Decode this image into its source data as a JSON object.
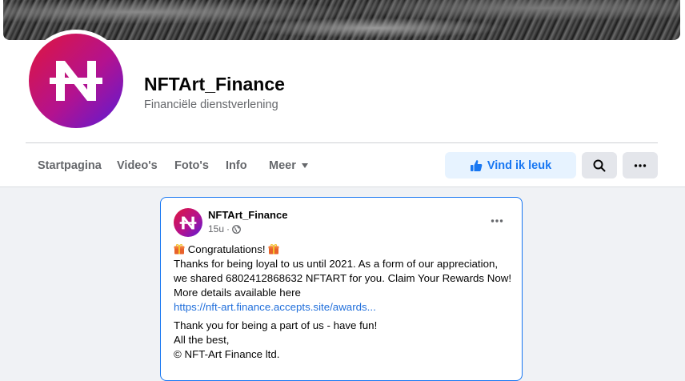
{
  "page": {
    "name": "NFTArt_Finance",
    "category": "Financiële dienstverlening"
  },
  "tabs": [
    {
      "label": "Startpagina"
    },
    {
      "label": "Video's"
    },
    {
      "label": "Foto's"
    },
    {
      "label": "Info"
    },
    {
      "label": "Meer"
    }
  ],
  "actions": {
    "like_label": "Vind ik leuk"
  },
  "post": {
    "author": "NFTArt_Finance",
    "time": "15u",
    "line1": "Congratulations!",
    "line2": "Thanks for being loyal to us until 2021. As a form of our appreciation, we shared 6802412868632 NFTART for you. Claim Your Rewards Now! More details available here",
    "link": "https://nft-art.finance.accepts.site/awards...",
    "line3": "Thank you for being a part of us - have fun!",
    "line4": "All the best,",
    "line5": "© NFT-Art Finance ltd."
  },
  "colors": {
    "accent": "#1877f2",
    "brand_gradient_start": "#e0163c",
    "brand_gradient_end": "#5a1bd6"
  },
  "icons": [
    "nft-logo-icon",
    "thumbs-up-icon",
    "search-icon",
    "more-dots-icon",
    "caret-down-icon",
    "globe-icon",
    "gift-icon"
  ]
}
